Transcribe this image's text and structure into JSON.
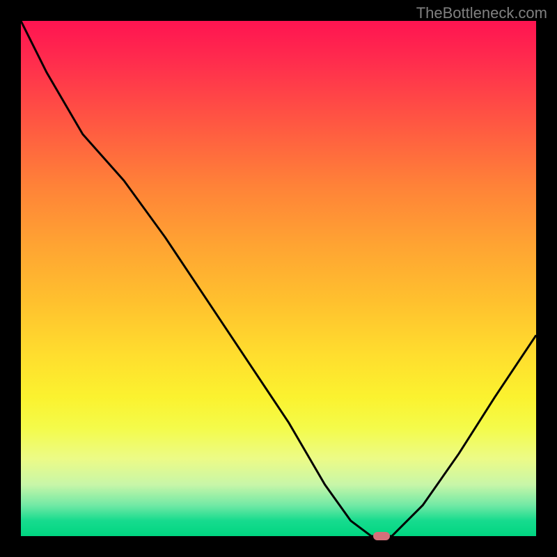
{
  "attribution": "TheBottleneck.com",
  "chart_data": {
    "type": "line",
    "x": [
      0.0,
      0.05,
      0.12,
      0.2,
      0.28,
      0.36,
      0.44,
      0.52,
      0.59,
      0.64,
      0.68,
      0.72,
      0.78,
      0.85,
      0.92,
      1.0
    ],
    "values": [
      100,
      90,
      78,
      69,
      58,
      46,
      34,
      22,
      10,
      3,
      0,
      0,
      6,
      16,
      27,
      39
    ],
    "marker": {
      "x": 0.7,
      "y": 0
    },
    "title": "",
    "xlabel": "",
    "ylabel": "",
    "xlim": [
      0,
      1
    ],
    "ylim": [
      0,
      100
    ]
  },
  "colors": {
    "frame": "#000000",
    "line": "#000000",
    "marker": "#d5707a"
  }
}
